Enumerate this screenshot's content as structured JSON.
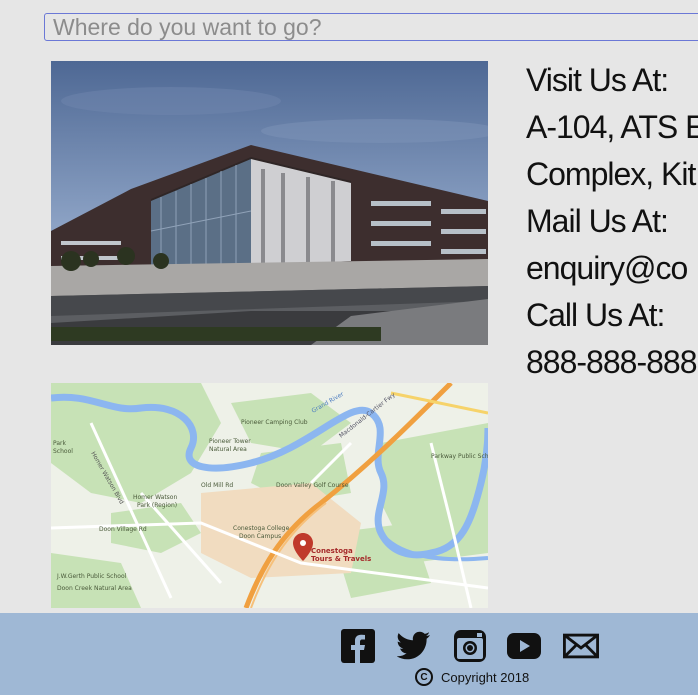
{
  "search": {
    "placeholder": "Where do you want to go?"
  },
  "contact": {
    "visit_heading": "Visit Us At:",
    "address_line1": "A-104, ATS E",
    "address_line2": "Complex, Kit",
    "mail_heading": "Mail Us At:",
    "email": "enquiry@co",
    "call_heading": "Call Us At:",
    "phone": "888-888-888"
  },
  "map": {
    "labels": {
      "pioneer_camping": "Pioneer Camping Club",
      "pioneer_tower": "Pioneer Tower",
      "natural_area": "Natural Area",
      "homer_watson": "Homer Watson",
      "park_region": "Park (Region)",
      "doon_valley_golf": "Doon Valley Golf Course",
      "conestoga_college": "Conestoga College",
      "doon_campus": "Doon Campus",
      "parkway_school": "Parkway Public School",
      "jw_gerth": "J.W.Gerth Public School",
      "doon_creek": "Doon Creek Natural Area",
      "park_school": "Park",
      "school": "School",
      "grand_river": "Grand River",
      "macdonald": "Macdonald-Cartier Fwy",
      "old_mill": "Old Mill Rd",
      "doon_village": "Doon Village Rd",
      "homer_watson_blvd": "Homer Watson Blvd",
      "marker_line1": "Conestoga",
      "marker_line2": "Tours & Travels"
    }
  },
  "footer": {
    "social": [
      "facebook-icon",
      "twitter-icon",
      "instagram-icon",
      "youtube-icon",
      "mail-icon"
    ],
    "copyright": "Copyright 2018"
  }
}
